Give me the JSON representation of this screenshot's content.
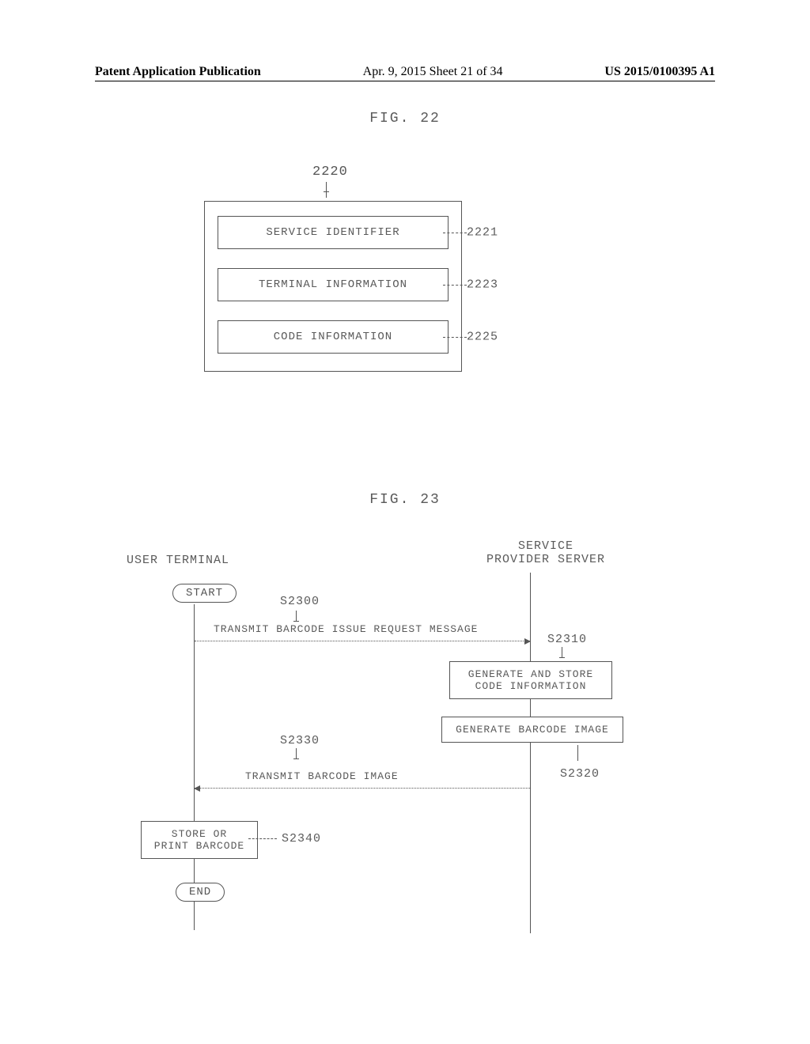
{
  "header": {
    "left": "Patent Application Publication",
    "mid": "Apr. 9, 2015  Sheet 21 of 34",
    "right": "US 2015/0100395 A1"
  },
  "fig22": {
    "title": "FIG. 22",
    "outer_ref": "2220",
    "rows": [
      {
        "label": "SERVICE IDENTIFIER",
        "ref": "2221"
      },
      {
        "label": "TERMINAL INFORMATION",
        "ref": "2223"
      },
      {
        "label": "CODE INFORMATION",
        "ref": "2225"
      }
    ]
  },
  "fig23": {
    "title": "FIG. 23",
    "actors": {
      "user": "USER TERMINAL",
      "server_line1": "SERVICE",
      "server_line2": "PROVIDER SERVER"
    },
    "start": "START",
    "end": "END",
    "steps": {
      "s2300": {
        "ref": "S2300",
        "label": "TRANSMIT BARCODE ISSUE REQUEST MESSAGE"
      },
      "s2310": {
        "ref": "S2310",
        "label": "GENERATE AND STORE CODE INFORMATION"
      },
      "s2320": {
        "ref": "S2320",
        "label": "GENERATE BARCODE IMAGE"
      },
      "s2330": {
        "ref": "S2330",
        "label": "TRANSMIT BARCODE IMAGE"
      },
      "s2340": {
        "ref": "S2340",
        "label": "STORE OR PRINT BARCODE"
      }
    }
  }
}
